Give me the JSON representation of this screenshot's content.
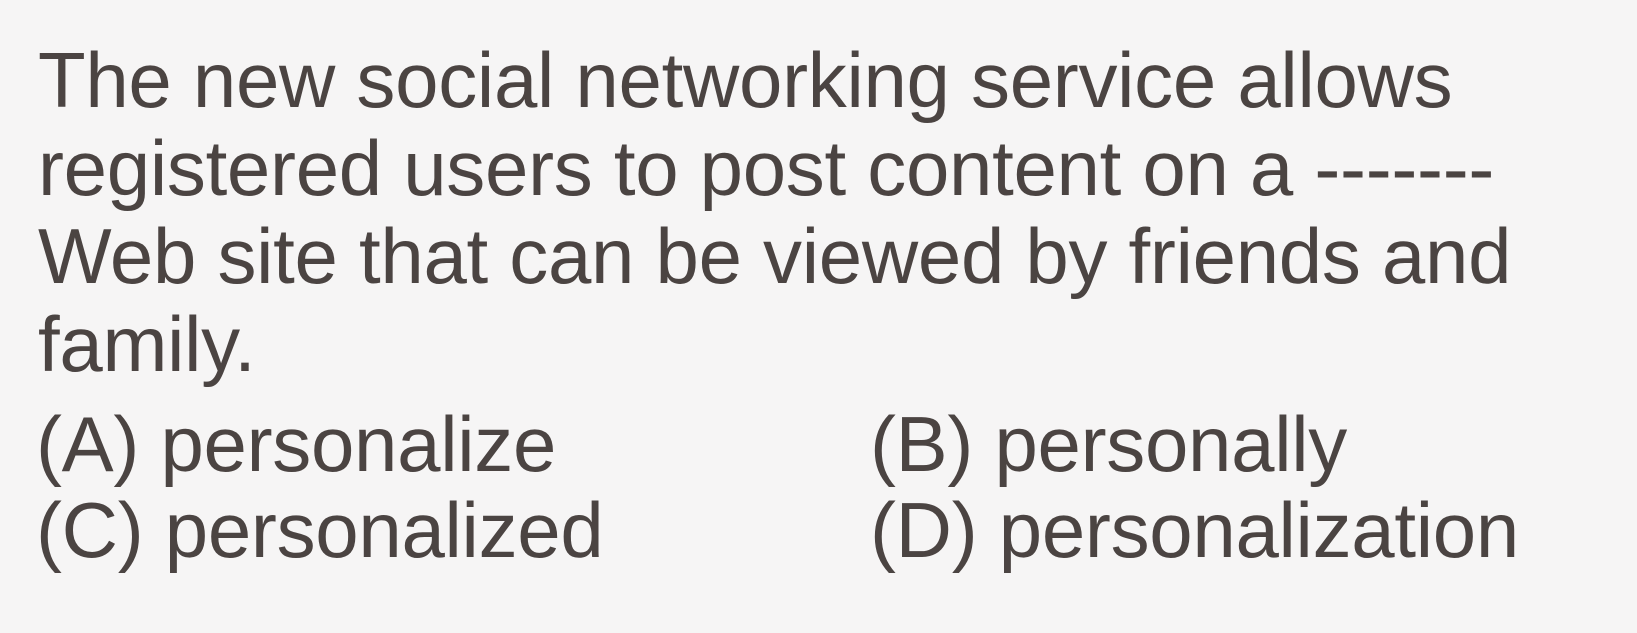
{
  "question": {
    "lines": [
      "The new social networking service allows",
      "registered users to post content on a -------",
      "Web site that can be viewed by friends and",
      "family."
    ]
  },
  "options": {
    "a": "(A) personalize",
    "b": "(B) personally",
    "c": "(C) personalized",
    "d": "(D) personalization"
  }
}
